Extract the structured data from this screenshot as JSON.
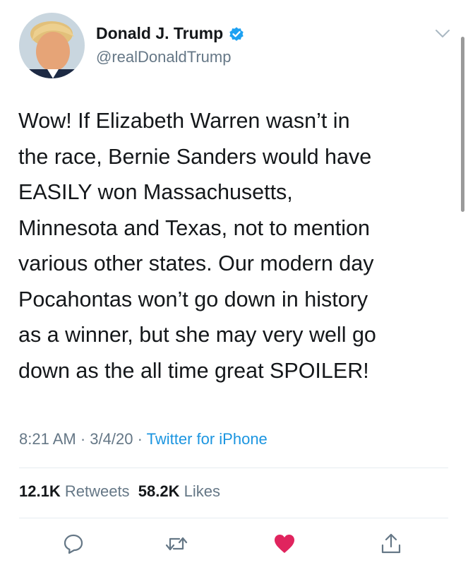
{
  "author": {
    "name": "Donald J. Trump",
    "handle": "@realDonaldTrump"
  },
  "tweet": {
    "lines": [
      "Wow! If Elizabeth Warren wasn’t in",
      "the race, Bernie Sanders would have",
      "EASILY won Massachusetts,",
      "Minnesota and Texas, not to mention",
      "various other states. Our modern day",
      "Pocahontas won’t go down in history",
      "as a winner, but she may very well go",
      "down as the all time great SPOILER!"
    ]
  },
  "meta": {
    "time": "8:21 AM",
    "sep1": " · ",
    "date": "3/4/20",
    "sep2": " · ",
    "source": "Twitter for iPhone"
  },
  "stats": {
    "retweets_count": "12.1K",
    "retweets_label": "Retweets",
    "likes_count": "58.2K",
    "likes_label": "Likes"
  },
  "icons": {
    "verified": "verified-badge-icon",
    "menu": "chevron-down-icon",
    "reply": "reply-icon",
    "retweet": "retweet-icon",
    "like": "heart-icon",
    "share": "share-icon"
  },
  "colors": {
    "text": "#14171a",
    "secondary": "#657786",
    "link": "#1b95e0",
    "verified": "#1da1f2",
    "like": "#e0245e"
  }
}
